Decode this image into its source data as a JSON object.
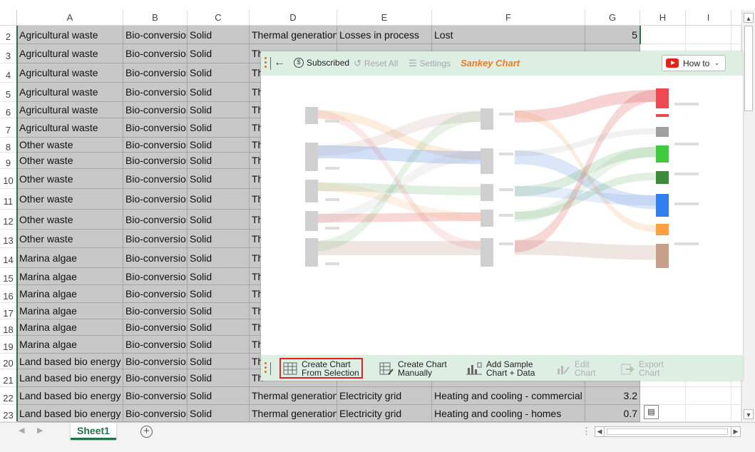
{
  "columns": [
    "A",
    "B",
    "C",
    "D",
    "E",
    "F",
    "G",
    "H",
    "I"
  ],
  "rows": [
    {
      "n": "2",
      "a": "Agricultural waste",
      "b": "Bio-conversion",
      "c": "Solid",
      "d": "Thermal generation",
      "e": "Losses in process",
      "f": "Lost",
      "g": "5"
    },
    {
      "n": "3",
      "a": "Agricultural waste",
      "b": "Bio-conversion",
      "c": "Solid",
      "d": "Th",
      "e": "",
      "f": "",
      "g": ""
    },
    {
      "n": "4",
      "a": "Agricultural waste",
      "b": "Bio-conversion",
      "c": "Solid",
      "d": "Th",
      "e": "",
      "f": "",
      "g": ""
    },
    {
      "n": "5",
      "a": "Agricultural waste",
      "b": "Bio-conversion",
      "c": "Solid",
      "d": "Th",
      "e": "",
      "f": "",
      "g": ""
    },
    {
      "n": "6",
      "a": "Agricultural waste",
      "b": "Bio-conversion",
      "c": "Solid",
      "d": "Th",
      "e": "",
      "f": "",
      "g": ""
    },
    {
      "n": "7",
      "a": "Agricultural waste",
      "b": "Bio-conversion",
      "c": "Solid",
      "d": "Th",
      "e": "",
      "f": "",
      "g": ""
    },
    {
      "n": "8",
      "a": "Other waste",
      "b": "Bio-conversion",
      "c": "Solid",
      "d": "Th",
      "e": "",
      "f": "",
      "g": ""
    },
    {
      "n": "9",
      "a": "Other waste",
      "b": "Bio-conversion",
      "c": "Solid",
      "d": "Th",
      "e": "",
      "f": "",
      "g": ""
    },
    {
      "n": "10",
      "a": "Other waste",
      "b": "Bio-conversion",
      "c": "Solid",
      "d": "Th",
      "e": "",
      "f": "",
      "g": ""
    },
    {
      "n": "11",
      "a": "Other waste",
      "b": "Bio-conversion",
      "c": "Solid",
      "d": "Th",
      "e": "",
      "f": "",
      "g": ""
    },
    {
      "n": "12",
      "a": "Other waste",
      "b": "Bio-conversion",
      "c": "Solid",
      "d": "Th",
      "e": "",
      "f": "",
      "g": ""
    },
    {
      "n": "13",
      "a": "Other waste",
      "b": "Bio-conversion",
      "c": "Solid",
      "d": "Th",
      "e": "",
      "f": "",
      "g": ""
    },
    {
      "n": "14",
      "a": "Marina algae",
      "b": "Bio-conversion",
      "c": "Solid",
      "d": "Th",
      "e": "",
      "f": "",
      "g": ""
    },
    {
      "n": "15",
      "a": "Marina algae",
      "b": "Bio-conversion",
      "c": "Solid",
      "d": "Th",
      "e": "",
      "f": "",
      "g": ""
    },
    {
      "n": "16",
      "a": "Marina algae",
      "b": "Bio-conversion",
      "c": "Solid",
      "d": "Th",
      "e": "",
      "f": "",
      "g": ""
    },
    {
      "n": "17",
      "a": "Marina algae",
      "b": "Bio-conversion",
      "c": "Solid",
      "d": "Th",
      "e": "",
      "f": "",
      "g": ""
    },
    {
      "n": "18",
      "a": "Marina algae",
      "b": "Bio-conversion",
      "c": "Solid",
      "d": "Th",
      "e": "",
      "f": "",
      "g": ""
    },
    {
      "n": "19",
      "a": "Marina algae",
      "b": "Bio-conversion",
      "c": "Solid",
      "d": "Th",
      "e": "",
      "f": "",
      "g": ""
    },
    {
      "n": "20",
      "a": "Land based bio energy",
      "b": "Bio-conversion",
      "c": "Solid",
      "d": "Th",
      "e": "",
      "f": "",
      "g": ""
    },
    {
      "n": "21",
      "a": "Land based bio energy",
      "b": "Bio-conversion",
      "c": "Solid",
      "d": "Th",
      "e": "",
      "f": "",
      "g": ""
    },
    {
      "n": "22",
      "a": "Land based bio energy",
      "b": "Bio-conversion",
      "c": "Solid",
      "d": "Thermal generation",
      "e": "Electricity grid",
      "f": "Heating and cooling - commercial",
      "g": "3.2"
    },
    {
      "n": "23",
      "a": "Land based bio energy",
      "b": "Bio-conversion",
      "c": "Solid",
      "d": "Thermal generation",
      "e": "Electricity grid",
      "f": "Heating and cooling - homes",
      "g": "0.7"
    }
  ],
  "sheet_tab": "Sheet1",
  "panel": {
    "subscribed": "Subscribed",
    "reset_all": "Reset All",
    "settings": "Settings",
    "title": "Sankey Chart",
    "how_to": "How to",
    "create_from_selection_1": "Create Chart",
    "create_from_selection_2": "From Selection",
    "create_manually_1": "Create Chart",
    "create_manually_2": "Manually",
    "add_sample_1": "Add Sample",
    "add_sample_2": "Chart + Data",
    "edit_1": "Edit",
    "edit_2": "Chart",
    "export_1": "Export",
    "export_2": "Chart"
  },
  "colors": {
    "accent": "#217346",
    "title": "#f07a22",
    "panel_bar": "#dcefe2",
    "highlight": "#e02222"
  },
  "sankey_node_colors": [
    "#f0484f",
    "#f0484f",
    "#a0a0a0",
    "#3ecb3e",
    "#3a8a3a",
    "#2f7ff0",
    "#ffa040",
    "#c8a08a"
  ]
}
